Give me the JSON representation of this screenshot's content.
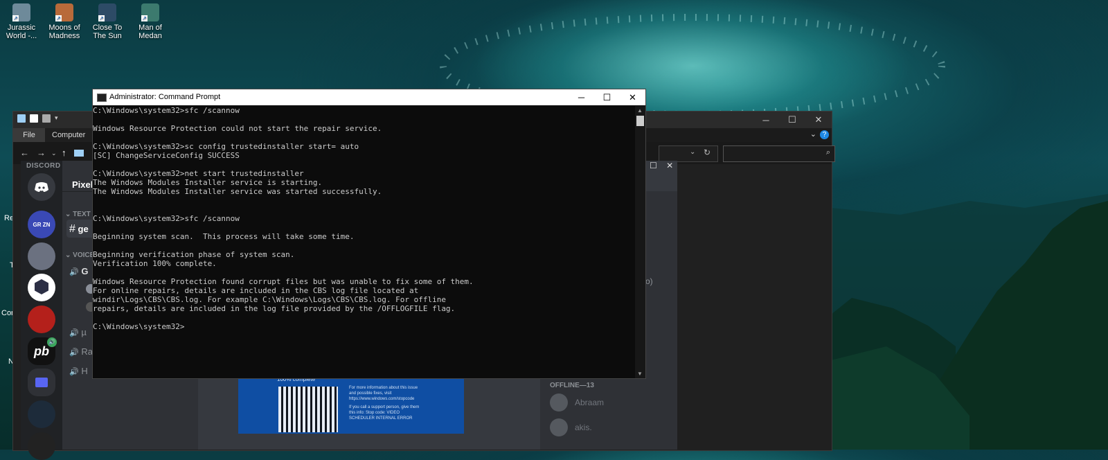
{
  "desktop": {
    "icons": [
      {
        "label": "Jurassic World -...",
        "icon": "jurassic-world-icon",
        "color": "#6e8a9a"
      },
      {
        "label": "Moons of Madness",
        "icon": "moons-of-madness-icon",
        "color": "#b86a3a"
      },
      {
        "label": "Close To The Sun",
        "icon": "close-to-the-sun-icon",
        "color": "#2d4b66"
      },
      {
        "label": "Man of Medan",
        "icon": "man-of-medan-icon",
        "color": "#3c7a6e"
      }
    ],
    "edge_labels": [
      "Re",
      "T",
      "Con",
      "N"
    ]
  },
  "explorer": {
    "ribbon_tabs": {
      "file": "File",
      "computer": "Computer"
    },
    "window_controls": [
      "minimize-icon",
      "maximize-icon",
      "close-icon"
    ]
  },
  "discord": {
    "logo_text": "DISCORD",
    "server_name": "Pixelb",
    "categories": {
      "text": "TEXT C",
      "voice": "VOICE"
    },
    "channels": [
      {
        "prefix": "#",
        "label": "ge"
      },
      {
        "prefix": "🔊",
        "label": "G"
      },
      {
        "prefix": "🔊",
        "label": "µ"
      },
      {
        "prefix": "🔊",
        "label": "Ra"
      },
      {
        "prefix": "🔊",
        "label": "H"
      }
    ],
    "members_offline_header": "OFFLINE—13",
    "members": [
      "Abraam",
      "akis."
    ],
    "partial_text": "o)",
    "image_caption": "100% complete",
    "image_text": "For more information about this issue and possible fixes, visit https://www.windows.com/stopcode",
    "image_support_text": "If you call a support person, give them this info: Stop code: VIDEO SCHEDULER INTERNAL ERROR"
  },
  "cmd": {
    "title": "Administrator: Command Prompt",
    "lines": [
      "C:\\Windows\\system32>sfc /scannow",
      "",
      "Windows Resource Protection could not start the repair service.",
      "",
      "C:\\Windows\\system32>sc config trustedinstaller start= auto",
      "[SC] ChangeServiceConfig SUCCESS",
      "",
      "C:\\Windows\\system32>net start trustedinstaller",
      "The Windows Modules Installer service is starting.",
      "The Windows Modules Installer service was started successfully.",
      "",
      "",
      "C:\\Windows\\system32>sfc /scannow",
      "",
      "Beginning system scan.  This process will take some time.",
      "",
      "Beginning verification phase of system scan.",
      "Verification 100% complete.",
      "",
      "Windows Resource Protection found corrupt files but was unable to fix some of them.",
      "For online repairs, details are included in the CBS log file located at",
      "windir\\Logs\\CBS\\CBS.log. For example C:\\Windows\\Logs\\CBS\\CBS.log. For offline",
      "repairs, details are included in the log file provided by the /OFFLOGFILE flag.",
      "",
      "C:\\Windows\\system32>"
    ]
  }
}
